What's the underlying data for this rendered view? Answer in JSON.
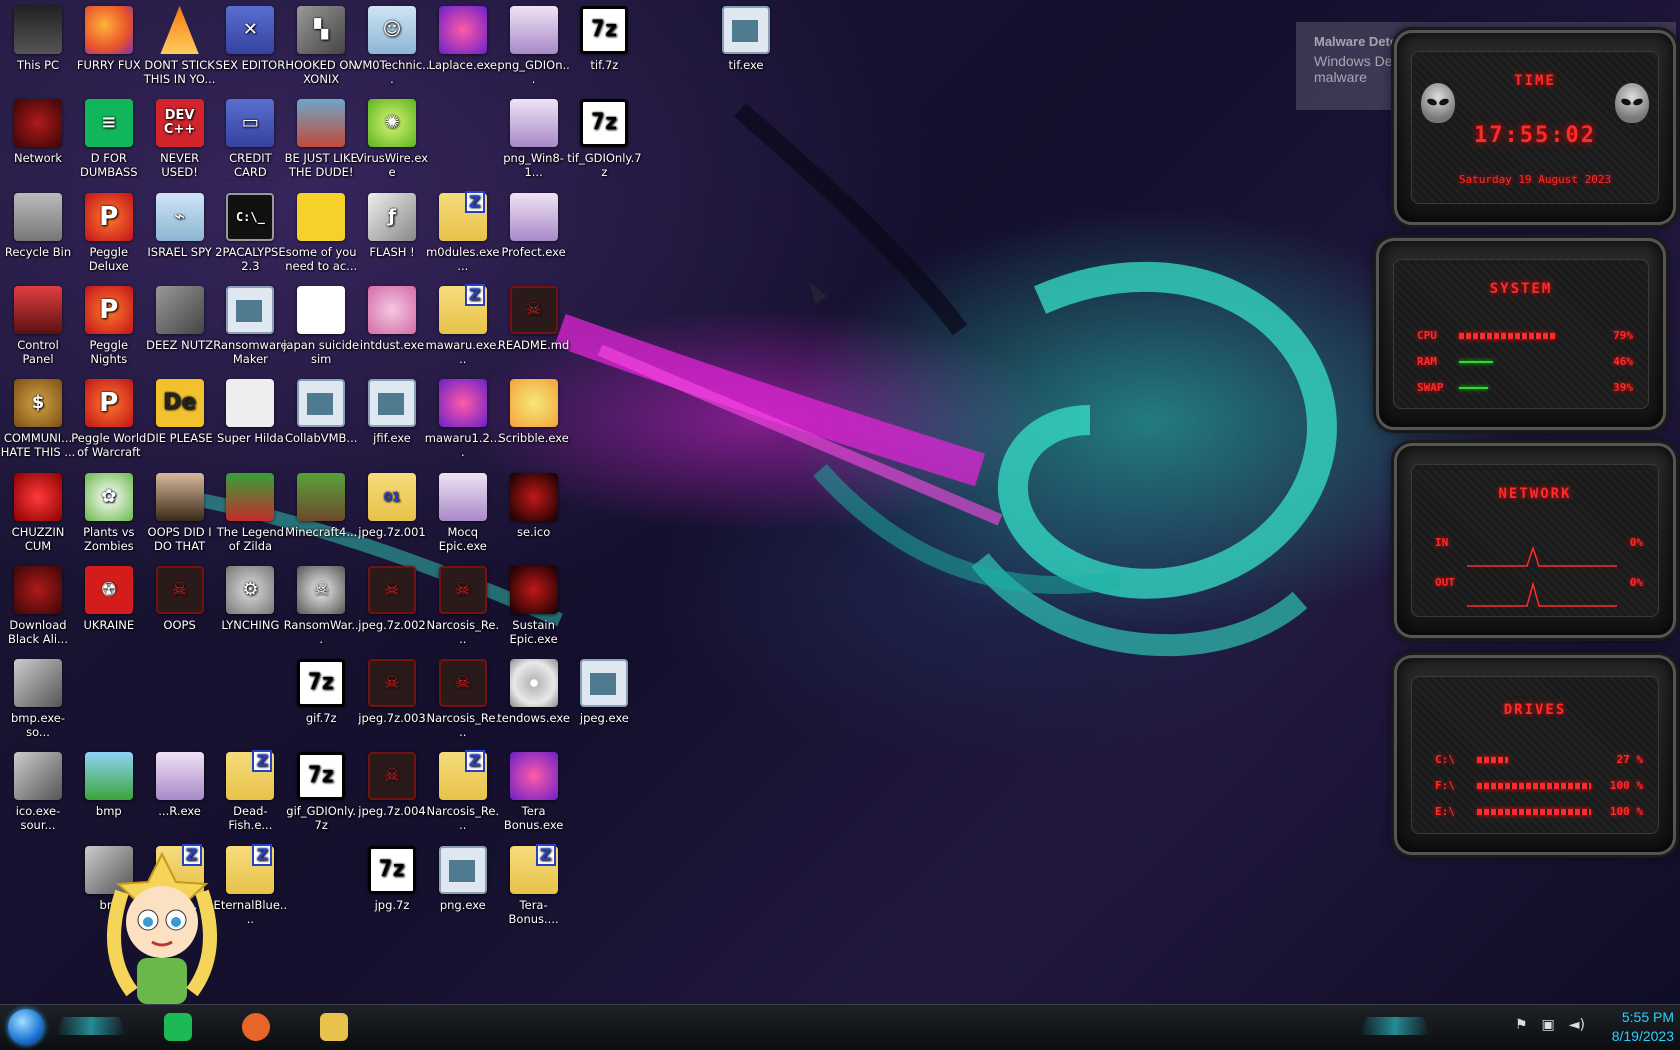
{
  "desktop": {
    "icons": [
      {
        "label": "This PC",
        "icon": "pc-icon",
        "glyph": "",
        "col": 0,
        "row": 0
      },
      {
        "label": "FURRY FUX",
        "icon": "firefox-icon",
        "glyph": "",
        "col": 1,
        "row": 0
      },
      {
        "label": "DONT STICK THIS IN YO...",
        "icon": "traffic-cone-icon",
        "glyph": "",
        "col": 2,
        "row": 0
      },
      {
        "label": "SEX EDITOR",
        "icon": "editor-icon",
        "glyph": "✕",
        "col": 3,
        "row": 0
      },
      {
        "label": "HOOKED ON XONIX",
        "icon": "game-icon",
        "glyph": "▚",
        "col": 4,
        "row": 0
      },
      {
        "label": "VM0Technic...",
        "icon": "doctor-icon",
        "glyph": "☺",
        "col": 5,
        "row": 0
      },
      {
        "label": "Laplace.exe",
        "icon": "noise-icon",
        "glyph": "",
        "col": 6,
        "row": 0
      },
      {
        "label": "png_GDIOn...",
        "icon": "anime-girl-icon",
        "glyph": "",
        "col": 7,
        "row": 0
      },
      {
        "label": "tif.7z",
        "icon": "7z-archive-icon",
        "glyph": "7z",
        "col": 8,
        "row": 0
      },
      {
        "label": "tif.exe",
        "icon": "window-exe-icon",
        "glyph": "",
        "col": 10,
        "row": 0
      },
      {
        "label": "Network",
        "icon": "red-skull-icon",
        "glyph": "",
        "col": 0,
        "row": 1
      },
      {
        "label": "D FOR DUMBASS",
        "icon": "spotify-icon",
        "glyph": "≡",
        "col": 1,
        "row": 1
      },
      {
        "label": "NEVER USED!",
        "icon": "devcpp-icon",
        "glyph": "DEV C++",
        "col": 2,
        "row": 1
      },
      {
        "label": "CREDIT CARD CHECKER",
        "icon": "credit-card-icon",
        "glyph": "▭",
        "col": 3,
        "row": 1
      },
      {
        "label": "BE JUST LIKE THE DUDE!",
        "icon": "dude-icon",
        "glyph": "",
        "col": 4,
        "row": 1
      },
      {
        "label": "VirusWire.exe",
        "icon": "lime-icon",
        "glyph": "✺",
        "col": 5,
        "row": 1
      },
      {
        "label": "png_Win8-1...",
        "icon": "anime-girl-icon",
        "glyph": "",
        "col": 7,
        "row": 1
      },
      {
        "label": "tif_GDIOnly.7z",
        "icon": "7z-archive-icon",
        "glyph": "7z",
        "col": 8,
        "row": 1
      },
      {
        "label": "Recycle Bin",
        "icon": "recycle-bin-icon",
        "glyph": "",
        "col": 0,
        "row": 2
      },
      {
        "label": "Peggle Deluxe",
        "icon": "peggle-icon",
        "glyph": "P",
        "col": 1,
        "row": 2
      },
      {
        "label": "ISRAEL SPY",
        "icon": "spy-icon",
        "glyph": "⌁",
        "col": 2,
        "row": 2
      },
      {
        "label": "2PACALYPSE 2.3",
        "icon": "cmd-icon",
        "glyph": "C:\\_",
        "col": 3,
        "row": 2
      },
      {
        "label": "some of you need to ac...",
        "icon": "dog-icon",
        "glyph": "",
        "col": 4,
        "row": 2
      },
      {
        "label": "FLASH !",
        "icon": "flash-icon",
        "glyph": "ƒ",
        "col": 5,
        "row": 2
      },
      {
        "label": "m0dules.exe...",
        "icon": "zip-folder-icon",
        "glyph": "Z",
        "col": 6,
        "row": 2
      },
      {
        "label": "Profect.exe",
        "icon": "anime-girl-icon",
        "glyph": "",
        "col": 7,
        "row": 2
      },
      {
        "label": "Control Panel",
        "icon": "control-panel-icon",
        "glyph": "",
        "col": 0,
        "row": 3
      },
      {
        "label": "Peggle Nights Deluxe",
        "icon": "peggle-icon",
        "glyph": "P",
        "col": 1,
        "row": 3
      },
      {
        "label": "DEEZ NUTZ",
        "icon": "cards-icon",
        "glyph": "",
        "col": 2,
        "row": 3
      },
      {
        "label": "Ransomware Maker Build...",
        "icon": "window-exe-icon",
        "glyph": "",
        "col": 3,
        "row": 3
      },
      {
        "label": "japan suicide sim",
        "icon": "document-icon",
        "glyph": "",
        "col": 4,
        "row": 3
      },
      {
        "label": "intdust.exe",
        "icon": "palette-icon",
        "glyph": "",
        "col": 5,
        "row": 3
      },
      {
        "label": "mawaru.exe...",
        "icon": "zip-folder-icon",
        "glyph": "Z",
        "col": 6,
        "row": 3
      },
      {
        "label": "README.md",
        "icon": "alienware-icon",
        "glyph": "☠",
        "col": 7,
        "row": 3
      },
      {
        "label": "COMMUNI... HATE THIS ...",
        "icon": "money-bag-icon",
        "glyph": "$",
        "col": 0,
        "row": 4
      },
      {
        "label": "Peggle World of Warcraft ...",
        "icon": "peggle-icon",
        "glyph": "P",
        "col": 1,
        "row": 4
      },
      {
        "label": "DIE PLEASE",
        "icon": "de-icon",
        "glyph": "De",
        "col": 2,
        "row": 4
      },
      {
        "label": "Super Hilda",
        "icon": "pixel-dog-icon",
        "glyph": "",
        "col": 3,
        "row": 4
      },
      {
        "label": "CollabVMB...",
        "icon": "monitor-icon",
        "glyph": "",
        "col": 4,
        "row": 4
      },
      {
        "label": "jfif.exe",
        "icon": "window-exe-icon",
        "glyph": "",
        "col": 5,
        "row": 4
      },
      {
        "label": "mawaru1.2....",
        "icon": "psychedelic-icon",
        "glyph": "",
        "col": 6,
        "row": 4
      },
      {
        "label": "Scribble.exe",
        "icon": "scribble-icon",
        "glyph": "",
        "col": 7,
        "row": 4
      },
      {
        "label": "CHUZZIN CUM",
        "icon": "chuzzle-icon",
        "glyph": "",
        "col": 0,
        "row": 5
      },
      {
        "label": "Plants vs Zombies",
        "icon": "plant-icon",
        "glyph": "✿",
        "col": 1,
        "row": 5
      },
      {
        "label": "OOPS DID I DO THAT",
        "icon": "portrait-icon",
        "glyph": "",
        "col": 2,
        "row": 5
      },
      {
        "label": "The Legend of Zilda",
        "icon": "zelda-icon",
        "glyph": "",
        "col": 3,
        "row": 5
      },
      {
        "label": "Minecraft4...",
        "icon": "minecraft-icon",
        "glyph": "",
        "col": 4,
        "row": 5
      },
      {
        "label": "jpeg.7z.001",
        "icon": "folder-01-icon",
        "glyph": "01",
        "col": 5,
        "row": 5
      },
      {
        "label": "Mocq Epic.exe",
        "icon": "anime-girl-icon",
        "glyph": "",
        "col": 6,
        "row": 5
      },
      {
        "label": "se.ico",
        "icon": "dark-red-icon",
        "glyph": "",
        "col": 7,
        "row": 5
      },
      {
        "label": "Download Black Ali...",
        "icon": "red-skull-icon",
        "glyph": "",
        "col": 0,
        "row": 6
      },
      {
        "label": "UKRAINE",
        "icon": "radiation-icon",
        "glyph": "☢",
        "col": 1,
        "row": 6
      },
      {
        "label": "OOPS",
        "icon": "alienware-icon",
        "glyph": "☠",
        "col": 2,
        "row": 6
      },
      {
        "label": "LYNCHING",
        "icon": "gear-icon",
        "glyph": "⚙",
        "col": 3,
        "row": 6
      },
      {
        "label": "RansomWar...",
        "icon": "skull-icon",
        "glyph": "☠",
        "col": 4,
        "row": 6
      },
      {
        "label": "jpeg.7z.002",
        "icon": "alienware-icon",
        "glyph": "☠",
        "col": 5,
        "row": 6
      },
      {
        "label": "Narcosis_Re...",
        "icon": "alienware-icon",
        "glyph": "☠",
        "col": 6,
        "row": 6
      },
      {
        "label": "Sustain Epic.exe",
        "icon": "dark-red-icon",
        "glyph": "",
        "col": 7,
        "row": 6
      },
      {
        "label": "bmp.exe-so...",
        "icon": "bmp-icon",
        "glyph": "",
        "col": 0,
        "row": 7
      },
      {
        "label": "gif.7z",
        "icon": "7z-archive-icon",
        "glyph": "7z",
        "col": 4,
        "row": 7
      },
      {
        "label": "jpeg.7z.003",
        "icon": "alienware-icon",
        "glyph": "☠",
        "col": 5,
        "row": 7
      },
      {
        "label": "Narcosis_Re...",
        "icon": "alienware-icon",
        "glyph": "☠",
        "col": 6,
        "row": 7
      },
      {
        "label": "tendows.exe",
        "icon": "cd-icon",
        "glyph": "",
        "col": 7,
        "row": 7
      },
      {
        "label": "jpeg.exe",
        "icon": "window-exe-icon",
        "glyph": "",
        "col": 8,
        "row": 7
      },
      {
        "label": "ico.exe-sour...",
        "icon": "bmp-icon",
        "glyph": "",
        "col": 0,
        "row": 8
      },
      {
        "label": "bmp",
        "icon": "photo-icon",
        "glyph": "",
        "col": 1,
        "row": 8
      },
      {
        "label": "...R.exe",
        "icon": "anime-girl-icon",
        "glyph": "",
        "col": 2,
        "row": 8
      },
      {
        "label": "Dead-Fish.e...",
        "icon": "zip-folder-icon",
        "glyph": "Z",
        "col": 3,
        "row": 8
      },
      {
        "label": "gif_GDIOnly.7z",
        "icon": "7z-archive-icon",
        "glyph": "7z",
        "col": 4,
        "row": 8
      },
      {
        "label": "jpeg.7z.004",
        "icon": "alienware-icon",
        "glyph": "☠",
        "col": 5,
        "row": 8
      },
      {
        "label": "Narcosis_Re...",
        "icon": "zip-folder-icon",
        "glyph": "Z",
        "col": 6,
        "row": 8
      },
      {
        "label": "Tera Bonus.exe",
        "icon": "psychedelic-icon",
        "glyph": "",
        "col": 7,
        "row": 8
      },
      {
        "label": "bm",
        "icon": "bmp-icon",
        "glyph": "",
        "col": 1,
        "row": 9
      },
      {
        "label": "...ex...",
        "icon": "zip-folder-icon",
        "glyph": "Z",
        "col": 2,
        "row": 9
      },
      {
        "label": "EternalBlue....",
        "icon": "zip-folder-icon",
        "glyph": "Z",
        "col": 3,
        "row": 9
      },
      {
        "label": "jpg.7z",
        "icon": "7z-archive-icon",
        "glyph": "7z",
        "col": 5,
        "row": 9
      },
      {
        "label": "png.exe",
        "icon": "window-exe-icon",
        "glyph": "",
        "col": 6,
        "row": 9
      },
      {
        "label": "Tera-Bonus....",
        "icon": "zip-folder-icon",
        "glyph": "Z",
        "col": 7,
        "row": 9
      }
    ]
  },
  "toast": {
    "title": "Malware Detected",
    "body": "Windows Defender is taking action to clean detected malware"
  },
  "widgets": {
    "time": {
      "title": "TIME",
      "clock": "17:55:02",
      "date": "Saturday 19 August 2023"
    },
    "system": {
      "title": "SYSTEM",
      "rows": [
        {
          "key": "CPU",
          "value": "79%",
          "level": 0.79,
          "style": "red"
        },
        {
          "key": "RAM",
          "value": "46%",
          "level": 0.46,
          "style": "green"
        },
        {
          "key": "SWAP",
          "value": "39%",
          "level": 0.39,
          "style": "green"
        }
      ]
    },
    "network": {
      "title": "NETWORK",
      "rows": [
        {
          "key": "IN",
          "value": "0%"
        },
        {
          "key": "OUT",
          "value": "0%"
        }
      ]
    },
    "drives": {
      "title": "DRIVES",
      "rows": [
        {
          "key": "C:\\",
          "value": "27 %",
          "level": 0.27
        },
        {
          "key": "F:\\",
          "value": "100 %",
          "level": 1.0
        },
        {
          "key": "E:\\",
          "value": "100 %",
          "level": 1.0
        }
      ]
    }
  },
  "taskbar": {
    "start_icon": "windows-orb-icon",
    "pinned": [
      {
        "icon": "spotify-icon",
        "color": "#1db954"
      },
      {
        "icon": "firefox-icon",
        "color": "#e8652a"
      },
      {
        "icon": "file-explorer-icon",
        "color": "#e8c24a"
      }
    ],
    "tray_icons": [
      "flag-icon",
      "network-icon",
      "volume-icon"
    ],
    "time": "5:55 PM",
    "date": "8/19/2023",
    "accent_color": "#2dd6e6"
  }
}
